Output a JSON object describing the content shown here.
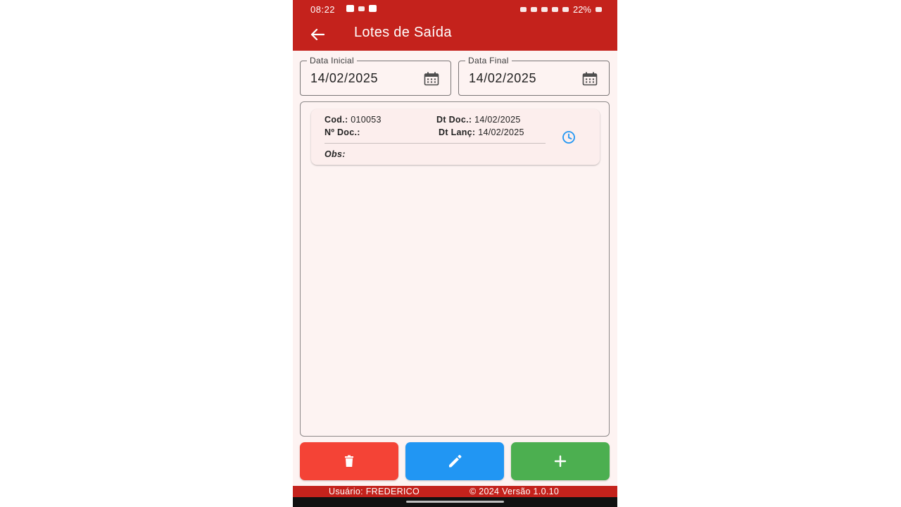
{
  "status_bar": {
    "time": "08:22",
    "battery": "22%"
  },
  "app_bar": {
    "title": "Lotes de Saída",
    "back_icon": "arrow-left-icon"
  },
  "filters": {
    "start_date": {
      "label": "Data Inicial",
      "value": "14/02/2025",
      "icon": "calendar-icon"
    },
    "end_date": {
      "label": "Data Final",
      "value": "14/02/2025",
      "icon": "calendar-icon"
    }
  },
  "lotes": [
    {
      "cod_label": "Cod.:",
      "cod": "010053",
      "ndoc_label": "Nº Doc.:",
      "ndoc": "",
      "dtdoc_label": "Dt Doc.:",
      "dtdoc": "14/02/2025",
      "dtlanc_label": "Dt Lanç:",
      "dtlanc": "14/02/2025",
      "obs_label": "Obs:",
      "obs": "",
      "icon": "clock-icon"
    }
  ],
  "actions": {
    "delete_icon": "trash-icon",
    "edit_icon": "pencil-icon",
    "add_icon": "plus-icon"
  },
  "colors": {
    "primary": "#c4221c",
    "background": "#fdf3f2",
    "card": "#fceeed",
    "delete": "#f44336",
    "edit": "#2196f3",
    "add": "#4caf50",
    "clock": "#2196f3"
  },
  "footer": {
    "user": "Usuário: FREDERICO",
    "version": "© 2024 Versão 1.0.10"
  }
}
